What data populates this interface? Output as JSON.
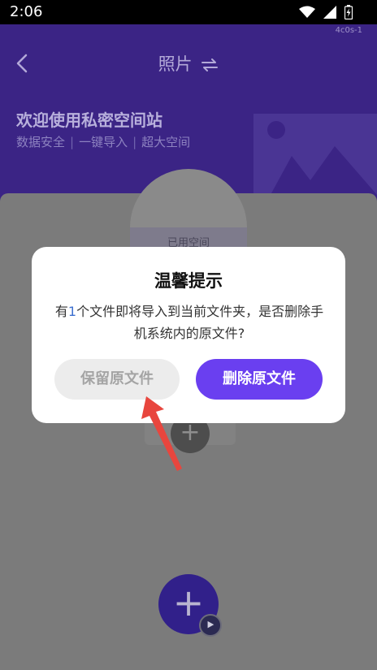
{
  "status_bar": {
    "time": "2:06",
    "icons": [
      "wifi-icon",
      "signal-icon",
      "battery-icon"
    ]
  },
  "header": {
    "debug_tag": "4c0s-1",
    "title": "照片",
    "welcome": "欢迎使用私密空间站",
    "tags": [
      "数据安全",
      "一键导入",
      "超大空间"
    ]
  },
  "content": {
    "space_label": "已用空间",
    "add_icon": "plus-icon",
    "fab_icon": "plus-icon",
    "fab_badge_icon": "play-icon"
  },
  "dialog": {
    "title": "温馨提示",
    "msg_prefix": "有",
    "msg_count": "1",
    "msg_suffix": "个文件即将导入到当前文件夹，是否删除手机系统内的原文件?",
    "keep_label": "保留原文件",
    "delete_label": "删除原文件"
  },
  "colors": {
    "accent": "#6a3ff0",
    "header_dimmed": "#3b2485",
    "overlay": "#7b7b7b",
    "annotation_arrow": "#e8463e"
  }
}
